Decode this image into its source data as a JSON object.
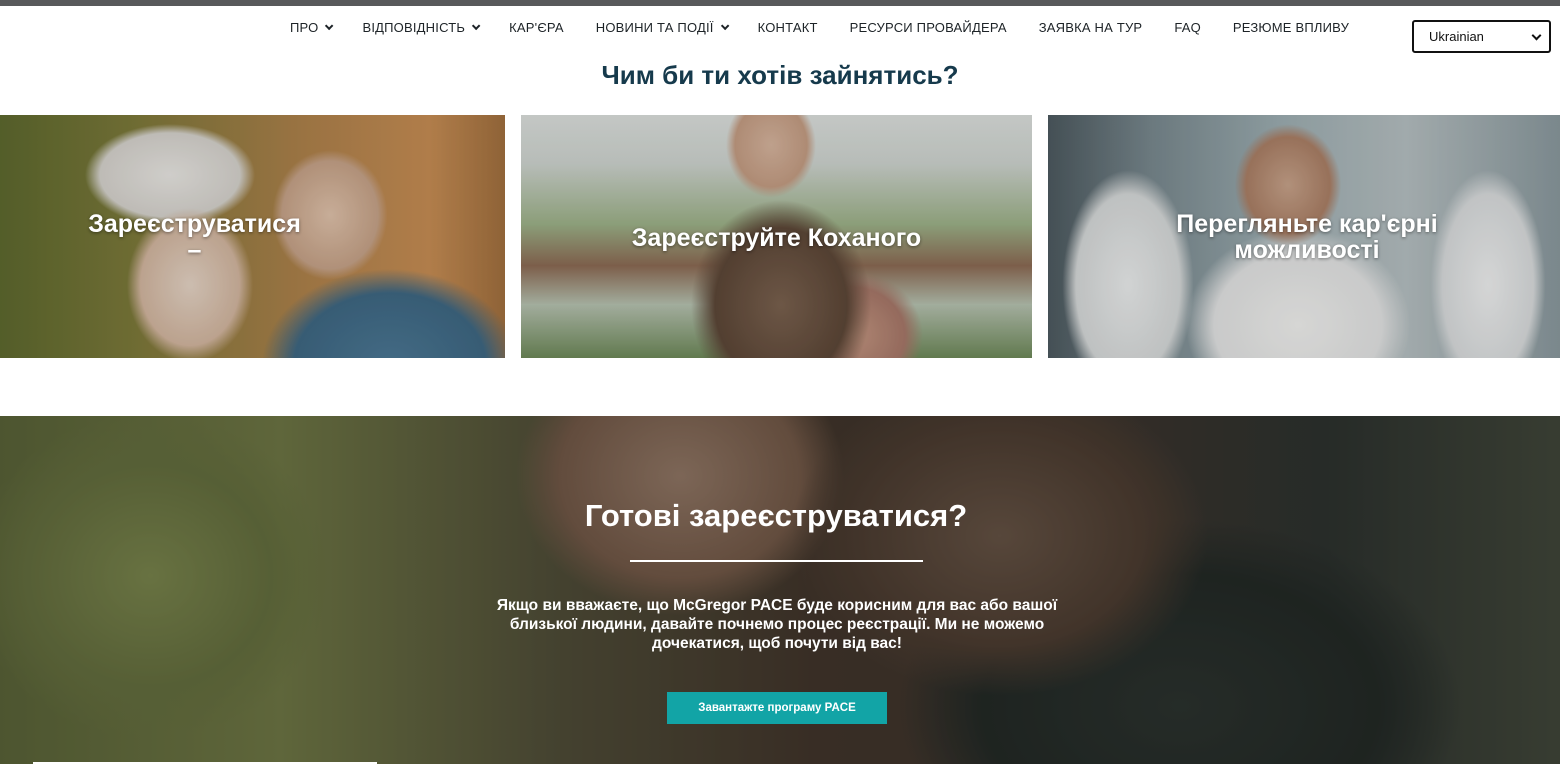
{
  "nav": {
    "items": [
      {
        "label": "ПРО",
        "dropdown": true
      },
      {
        "label": "ВІДПОВІДНІСТЬ",
        "dropdown": true
      },
      {
        "label": "КАР'ЄРА",
        "dropdown": false
      },
      {
        "label": "НОВИНИ ТА ПОДІЇ",
        "dropdown": true
      },
      {
        "label": "КОНТАКТ",
        "dropdown": false
      },
      {
        "label": "РЕСУРСИ ПРОВАЙДЕРА",
        "dropdown": false
      },
      {
        "label": "ЗАЯВКА НА ТУР",
        "dropdown": false
      },
      {
        "label": "FAQ",
        "dropdown": false
      },
      {
        "label": "РЕЗЮМЕ ВПЛИВУ",
        "dropdown": false
      }
    ],
    "language": {
      "selected": "Ukrainian"
    }
  },
  "section": {
    "title": "Чим би ти хотів зайнятись?"
  },
  "cards": [
    {
      "label": "Зареєструватися",
      "sub": "–"
    },
    {
      "label": "Зареєструйте Коханого"
    },
    {
      "label_line1": "Перегляньте кар'єрні",
      "label_line2": "можливості"
    }
  ],
  "hero": {
    "title": "Готові зареєструватися?",
    "text": "Якщо ви вважаєте, що McGregor PACE буде корисним для вас або вашої близької людини, давайте почнемо процес реєстрації. Ми не можемо дочекатися, щоб почути від вас!",
    "button_label": "Завантажте програму PACE",
    "accent_color": "#12a4a6"
  },
  "colors": {
    "heading": "#163a4c",
    "top_strip": "#58595b"
  }
}
